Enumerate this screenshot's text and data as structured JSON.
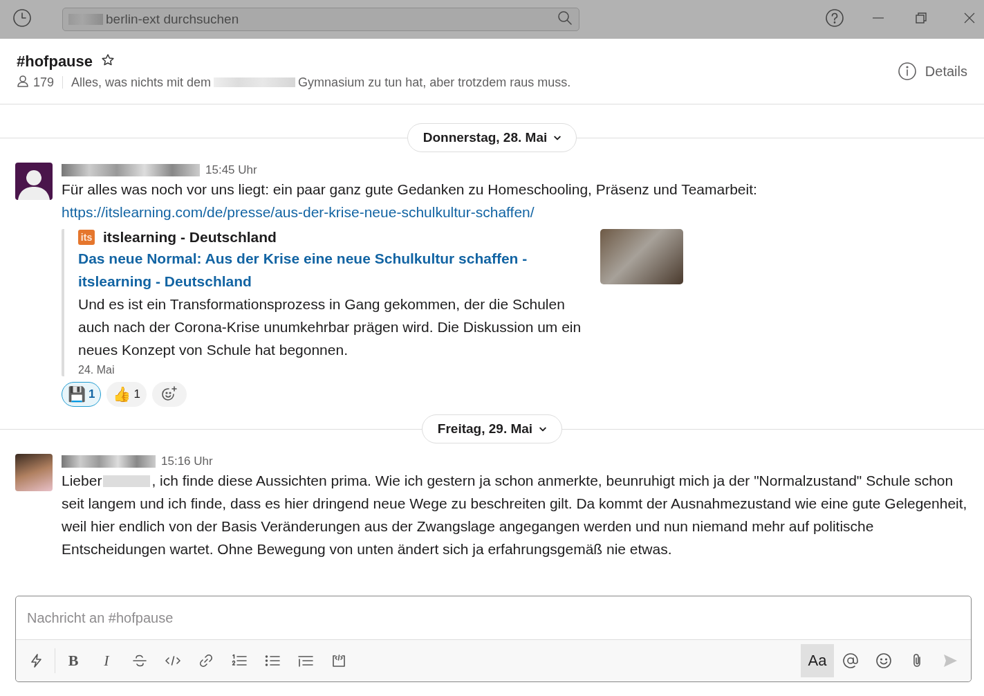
{
  "titlebar": {
    "search": {
      "placeholder": "berlin-ext durchsuchen"
    }
  },
  "channel": {
    "name": "#hofpause",
    "starred": false,
    "members": "179",
    "topic_before": "Alles, was nichts mit dem",
    "topic_after": "Gymnasium zu tun hat, aber trotzdem raus muss.",
    "details": "Details"
  },
  "days": [
    {
      "label": "Donnerstag, 28. Mai",
      "messages": [
        {
          "kind": "silhouette",
          "time": "15:45 Uhr",
          "parts": [
            {
              "kind": "text",
              "text": "Für alles was noch vor uns liegt: ein paar ganz gute Gedanken zu Homeschooling, Präsenz und Teamarbeit:"
            }
          ],
          "link": "https://itslearning.com/de/presse/aus-der-krise-neue-schulkultur-schaffen/",
          "attachment": {
            "icon": "its",
            "site": "itslearning - Deutschland",
            "title": "Das neue Normal: Aus der Krise eine neue Schulkultur schaffen - itslearning - Deutschland",
            "description": "Und es ist ein Transformationsprozess in Gang gekommen, der die Schulen auch nach der Corona-Krise unumkehrbar prägen wird. Die Diskussion um ein neues Konzept von Schule hat begonnen.",
            "date": "24. Mai"
          },
          "reactions": [
            {
              "emoji": "💾",
              "count": "1",
              "selected": true
            },
            {
              "emoji": "👍",
              "count": "1",
              "selected": false
            }
          ]
        }
      ]
    },
    {
      "label": "Freitag, 29. Mai",
      "messages": [
        {
          "kind": "photo",
          "time": "15:16 Uhr",
          "parts": [
            {
              "kind": "text",
              "text": "Lieber"
            },
            {
              "kind": "redacted"
            },
            {
              "kind": "text",
              "text": ", ich finde diese Aussichten prima. Wie ich gestern ja schon anmerkte, beunruhigt mich ja der \"Normalzustand\" Schule schon seit langem und ich finde, dass es hier dringend neue Wege zu beschreiten gilt. Da kommt der Ausnahmezustand wie eine gute Gelegenheit, weil hier endlich von der Basis Veränderungen aus der Zwangslage angegangen werden und nun niemand mehr auf politische Entscheidungen wartet. Ohne Bewegung von unten ändert sich ja erfahrungsgemäß nie etwas."
            }
          ]
        }
      ]
    }
  ],
  "composer": {
    "placeholder": "Nachricht an #hofpause",
    "tools": [
      {
        "kind": "shortcut"
      },
      {
        "kind": "bold",
        "label": "B"
      },
      {
        "kind": "italic",
        "label": "I"
      },
      {
        "kind": "strike"
      },
      {
        "kind": "code"
      },
      {
        "kind": "link"
      },
      {
        "kind": "ordered"
      },
      {
        "kind": "bullets"
      },
      {
        "kind": "quote"
      },
      {
        "kind": "codeblock"
      }
    ],
    "actions": [
      {
        "kind": "format",
        "label": "Aa",
        "selected": true
      },
      {
        "kind": "mention"
      },
      {
        "kind": "emoji"
      },
      {
        "kind": "attach"
      },
      {
        "kind": "send",
        "disabled": true
      }
    ]
  }
}
